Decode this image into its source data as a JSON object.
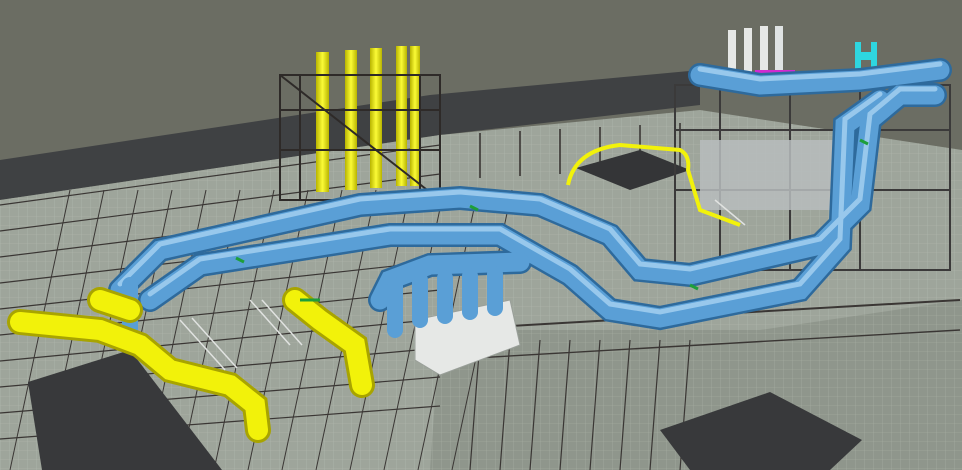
{
  "scene": {
    "description_visible_text": "",
    "colors": {
      "background": "#6b6d63",
      "deck": "#9ea59b",
      "deck_grid": "#b9c0b5",
      "structure_steel": "#3a3634",
      "roof_dark": "#383a3c",
      "pipe_blue": "#5a9fd6",
      "pipe_blue_highlight": "#a8d3f2",
      "pipe_blue_shadow": "#2e6a9c",
      "pipe_yellow": "#f2f20a",
      "pipe_yellow_shadow": "#a8a400",
      "pipe_green_accent": "#1e9e3a",
      "equipment_white": "#e6e8e6",
      "accent_magenta": "#d12ad1",
      "accent_cyan": "#2ed6e0"
    },
    "icons": [
      "stack-icon",
      "pipe-rack-icon",
      "stair-icon"
    ]
  }
}
